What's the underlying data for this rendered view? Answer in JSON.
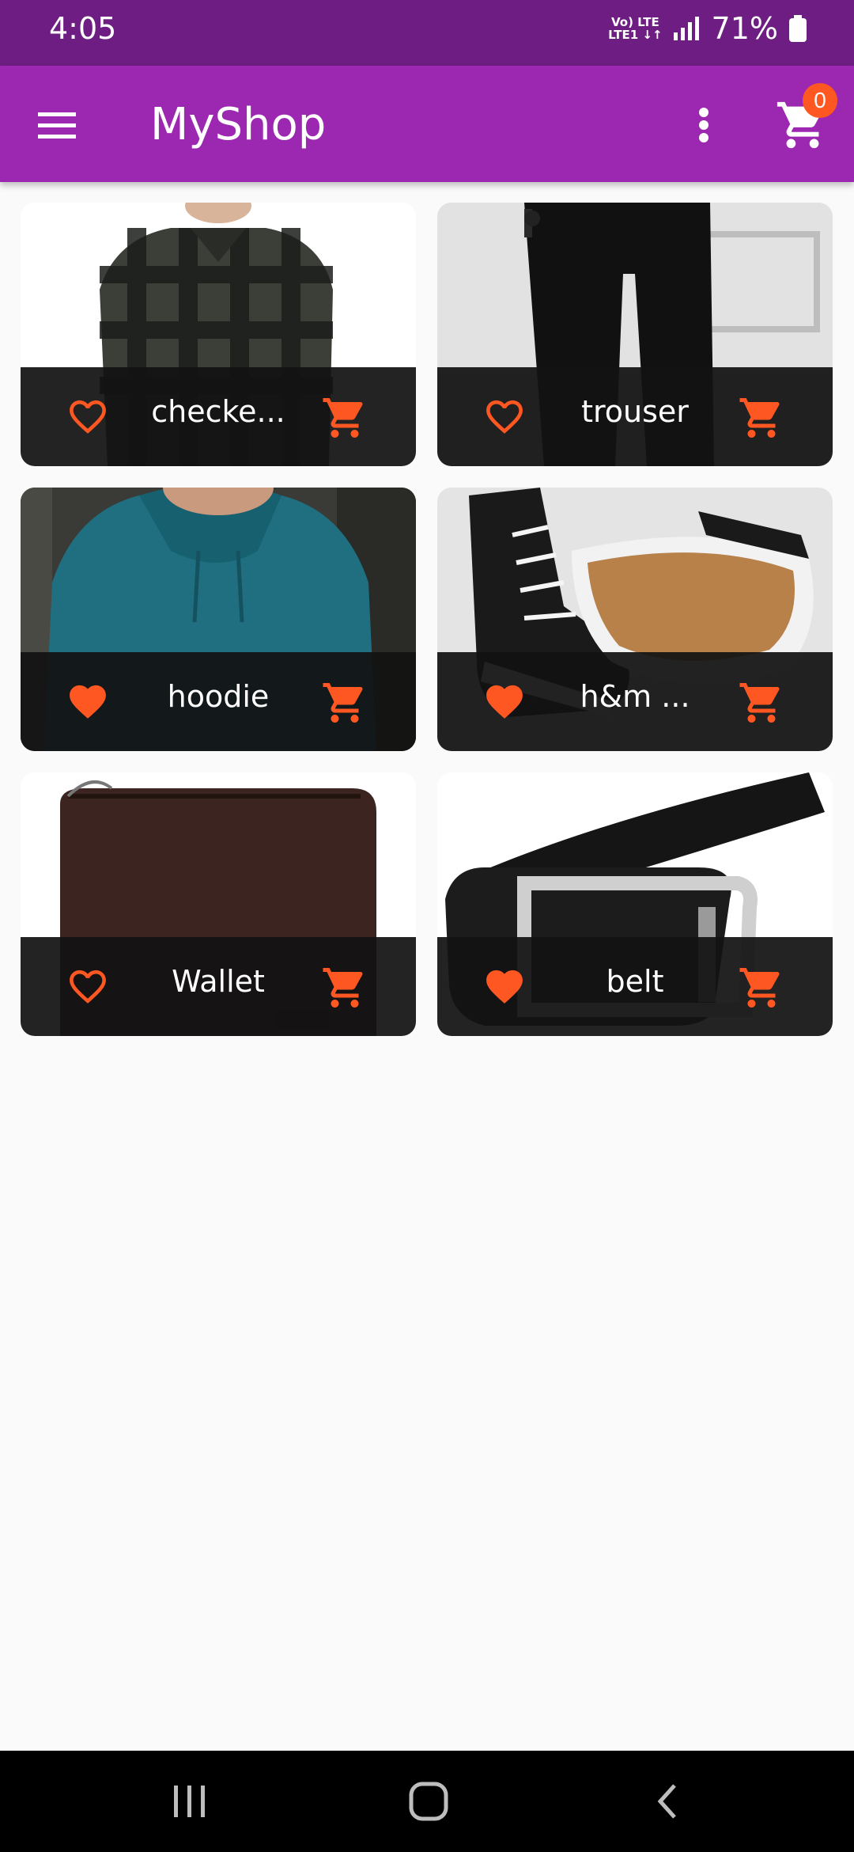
{
  "status_bar": {
    "time": "4:05",
    "network_top": "Vo) LTE",
    "network_bottom": "LTE1 ↓↑",
    "battery_percent": "71%"
  },
  "app_bar": {
    "title": "MyShop",
    "cart_count": "0"
  },
  "products": [
    {
      "label": "checke...",
      "favorite": false,
      "image": "checked-shirt"
    },
    {
      "label": "trouser",
      "favorite": false,
      "image": "black-trouser"
    },
    {
      "label": "hoodie",
      "favorite": true,
      "image": "teal-hoodie"
    },
    {
      "label": "h&m ...",
      "favorite": true,
      "image": "black-sneakers"
    },
    {
      "label": "Wallet",
      "favorite": false,
      "image": "brown-wallet"
    },
    {
      "label": "belt",
      "favorite": true,
      "image": "black-belt"
    }
  ],
  "colors": {
    "status_bar": "#6e1e82",
    "app_bar": "#9c27b0",
    "accent": "#ff5722",
    "card_footer": "#121212",
    "background": "#fafafa"
  }
}
